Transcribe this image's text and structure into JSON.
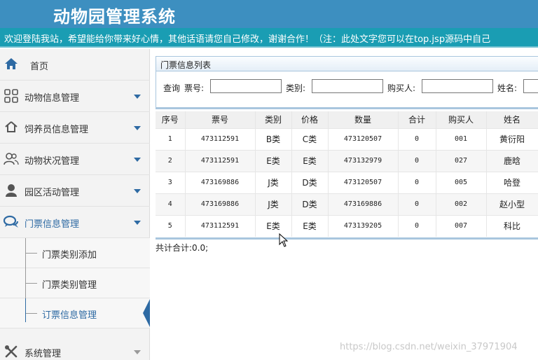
{
  "header": {
    "title": "动物园管理系统",
    "notice": "欢迎登陆我站，希望能给你带来好心情，其他话语请您自己修改，谢谢合作！（注：此处文字您可以在top.jsp源码中自己"
  },
  "sidebar": {
    "items": [
      {
        "label": "首页",
        "icon": "home-icon"
      },
      {
        "label": "动物信息管理",
        "icon": "grid-icon"
      },
      {
        "label": "饲养员信息管理",
        "icon": "home-outline-icon"
      },
      {
        "label": "动物状况管理",
        "icon": "users-icon"
      },
      {
        "label": "园区活动管理",
        "icon": "user-icon"
      },
      {
        "label": "门票信息管理",
        "icon": "comments-icon"
      },
      {
        "label": "系统管理",
        "icon": "wrench-icon"
      }
    ],
    "subitems": [
      {
        "label": "门票类别添加"
      },
      {
        "label": "门票类别管理"
      },
      {
        "label": "订票信息管理"
      }
    ]
  },
  "panel": {
    "title": "门票信息列表"
  },
  "search": {
    "query_label": "查询",
    "ticket_no_label": "票号:",
    "ticket_no_value": "",
    "category_label": "类别:",
    "category_value": "",
    "buyer_label": "购买人:",
    "buyer_value": "",
    "name_label": "姓名:",
    "name_value": ""
  },
  "table": {
    "headers": [
      "序号",
      "票号",
      "类别",
      "价格",
      "数量",
      "合计",
      "购买人",
      "姓名"
    ],
    "rows": [
      [
        "1",
        "473112591",
        "B类",
        "C类",
        "473120507",
        "0",
        "001",
        "黄衍阳"
      ],
      [
        "2",
        "473112591",
        "E类",
        "E类",
        "473132979",
        "0",
        "027",
        "鹿晗"
      ],
      [
        "3",
        "473169886",
        "J类",
        "D类",
        "473120507",
        "0",
        "005",
        "哈登"
      ],
      [
        "4",
        "473169886",
        "J类",
        "D类",
        "473169886",
        "0",
        "002",
        "赵小型"
      ],
      [
        "5",
        "473112591",
        "E类",
        "E类",
        "473139205",
        "0",
        "007",
        "科比"
      ]
    ]
  },
  "footer": {
    "total": "共计合计:0.0;"
  },
  "watermark": "https://blog.csdn.net/weixin_37971904"
}
